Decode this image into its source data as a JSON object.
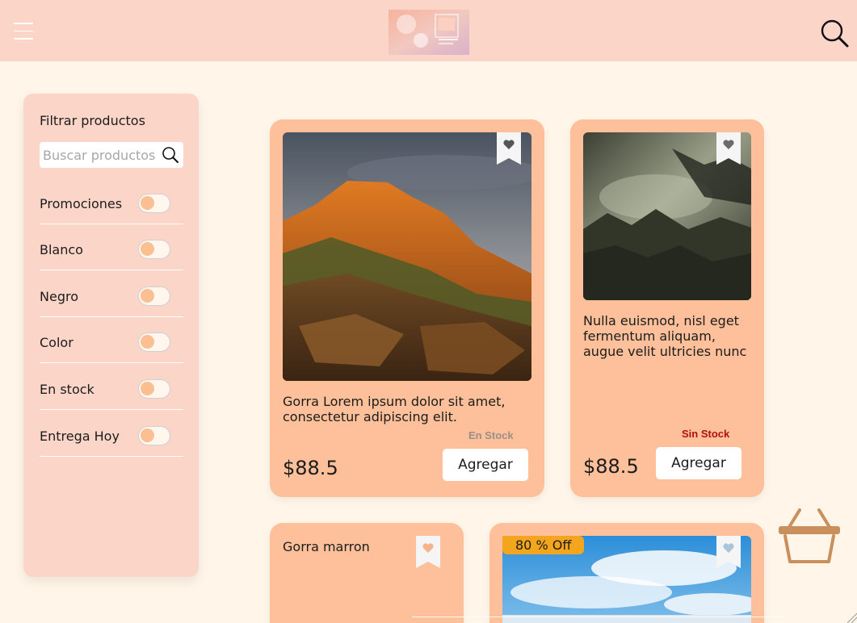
{
  "header": {
    "menu_icon": "hamburger-icon",
    "logo_alt": "Logo",
    "search_icon": "search-icon"
  },
  "sidebar": {
    "title": "Filtrar productos",
    "search_placeholder": "Buscar productos",
    "filters": [
      {
        "label": "Promociones",
        "on": false
      },
      {
        "label": "Blanco",
        "on": false
      },
      {
        "label": "Negro",
        "on": false
      },
      {
        "label": "Color",
        "on": false
      },
      {
        "label": "En stock",
        "on": false
      },
      {
        "label": "Entrega Hoy",
        "on": false
      }
    ]
  },
  "products": [
    {
      "description": "Gorra Lorem ipsum dolor sit amet, consectetur adipiscing elit.",
      "stock": "En Stock",
      "price": "$88.5",
      "button": "Agregar",
      "image": "sunset-rock-landscape"
    },
    {
      "description": "Nulla euismod, nisl eget fermentum aliquam, augue velit ultricies nunc",
      "stock": "Sin Stock",
      "price": "$88.5",
      "button": "Agregar",
      "image": "misty-forest"
    },
    {
      "description": "Gorra marron"
    },
    {
      "badge": "80 % Off",
      "image": "sky-clouds"
    }
  ],
  "colors": {
    "header_bg": "#fcd5c9",
    "page_bg": "#fff5e8",
    "card_bg": "#fdc09a",
    "in_stock": "#9a8f8a",
    "out_of_stock": "#b01010",
    "badge": "#f3a51e",
    "cart": "#c98f5c"
  },
  "cart_icon": "shopping-basket-icon"
}
